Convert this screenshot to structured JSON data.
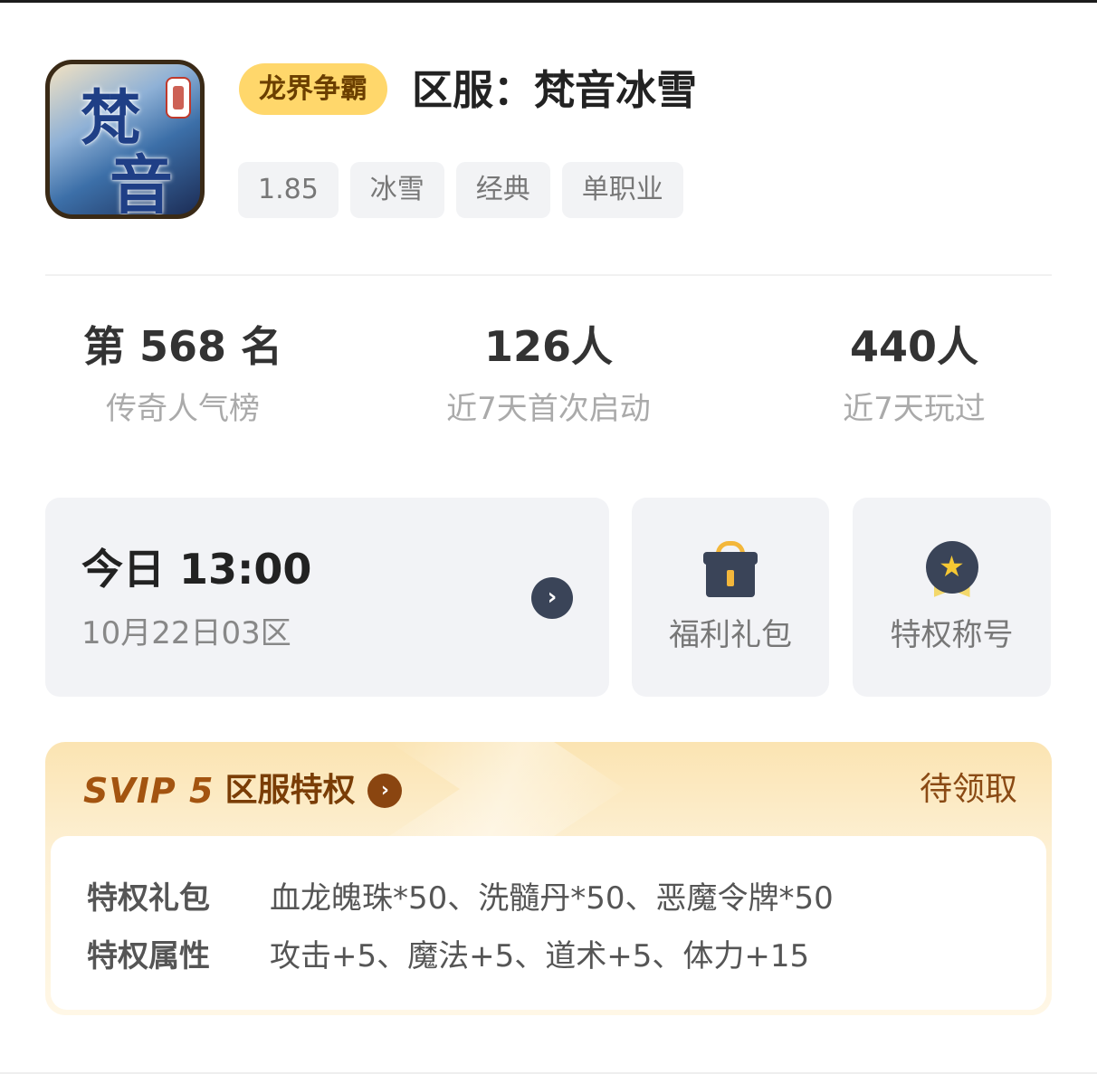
{
  "header": {
    "game_badge": "龙界争霸",
    "server_title": "区服：梵音冰雪",
    "tags": [
      "1.85",
      "冰雪",
      "经典",
      "单职业"
    ]
  },
  "stats": [
    {
      "value": "第 568 名",
      "label": "传奇人气榜"
    },
    {
      "value": "126人",
      "label": "近7天首次启动"
    },
    {
      "value": "440人",
      "label": "近7天玩过"
    }
  ],
  "open_server": {
    "time": "今日 13:00",
    "date_zone": "10月22日03区",
    "arrow_icon": "chevron-right-icon"
  },
  "actions": {
    "gift": {
      "label": "福利礼包",
      "icon": "gift-icon"
    },
    "title": {
      "label": "特权称号",
      "icon": "medal-star-icon"
    }
  },
  "svip": {
    "logo": "SVIP 5",
    "title": "区服特权",
    "status": "待领取",
    "rows": [
      {
        "label": "特权礼包",
        "value": "血龙魄珠*50、洗髓丹*50、恶魔令牌*50"
      },
      {
        "label": "特权属性",
        "value": "攻击+5、魔法+5、道术+5、体力+15"
      }
    ]
  },
  "colors": {
    "badge_bg": "#ffd76b",
    "svip_accent": "#a35410",
    "icon_dark": "#3a4458",
    "icon_gold": "#f3b73b"
  }
}
